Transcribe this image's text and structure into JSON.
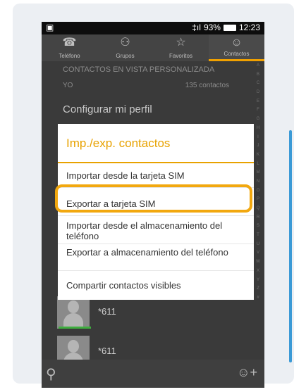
{
  "status": {
    "signal": "‡ıl",
    "battery": "93%",
    "time": "12:23",
    "left_icon": "image-icon"
  },
  "tabs": [
    {
      "label": "Teléfono",
      "icon": "phone-icon",
      "glyph": "☎"
    },
    {
      "label": "Grupos",
      "icon": "groups-icon",
      "glyph": "⚇"
    },
    {
      "label": "Favoritos",
      "icon": "star-icon",
      "glyph": "☆"
    },
    {
      "label": "Contactos",
      "icon": "contact-icon",
      "glyph": "☺"
    }
  ],
  "content": {
    "section_header": "CONTACTOS EN VISTA PERSONALIZADA",
    "me_label": "YO",
    "contact_count": "135 contactos",
    "profile_link": "Configurar mi perfil",
    "contacts": [
      "*611",
      "*611"
    ],
    "alphabet": [
      "A",
      "B",
      "C",
      "D",
      "E",
      "F",
      "G",
      "H",
      "I",
      "J",
      "K",
      "L",
      "M",
      "N",
      "O",
      "P",
      "Q",
      "R",
      "S",
      "T",
      "U",
      "V",
      "W",
      "X",
      "Y",
      "Z",
      "#"
    ]
  },
  "dialog": {
    "title": "Imp./exp. contactos",
    "items": [
      "Importar desde la tarjeta SIM",
      "Exportar a tarjeta SIM",
      "Importar desde el almacenamiento del teléfono",
      "Exportar a almacenamiento del teléfono",
      "Compartir contactos visibles"
    ],
    "highlighted_index": 1
  },
  "colors": {
    "accent": "#e8a200",
    "highlight": "#f2a80f",
    "sim_indicator": "#3fae3f"
  }
}
